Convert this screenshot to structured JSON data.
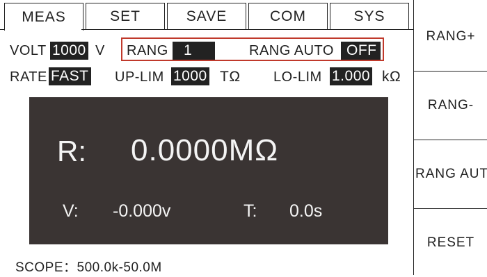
{
  "tabs": [
    {
      "label": "MEAS",
      "active": true
    },
    {
      "label": "SET",
      "active": false
    },
    {
      "label": "SAVE",
      "active": false
    },
    {
      "label": "COM",
      "active": false
    },
    {
      "label": "SYS",
      "active": false
    }
  ],
  "params": {
    "volt_label": "VOLT",
    "volt_value": "1000",
    "volt_unit": "V",
    "rang_label": "RANG",
    "rang_value": "1",
    "rang_auto_label": "RANG AUTO",
    "rang_auto_value": "OFF",
    "rate_label": "RATE",
    "rate_value": "FAST",
    "uplim_label": "UP-LIM",
    "uplim_value": "1000",
    "uplim_unit": "TΩ",
    "lolim_label": "LO-LIM",
    "lolim_value": "1.000",
    "lolim_unit": "kΩ"
  },
  "display": {
    "r_label": "R:",
    "r_value": "0.0000MΩ",
    "v_label": "V:",
    "v_value": "-0.000v",
    "t_label": "T:",
    "t_value": "0.0s"
  },
  "scope": "SCOPE：500.0k-50.0M",
  "side_buttons": [
    "RANG+",
    "RANG-",
    "RANG AUTO",
    "RESET"
  ],
  "colors": {
    "display_bg": "#3a3433",
    "highlight_border": "#c0392b",
    "value_bg": "#222222"
  }
}
